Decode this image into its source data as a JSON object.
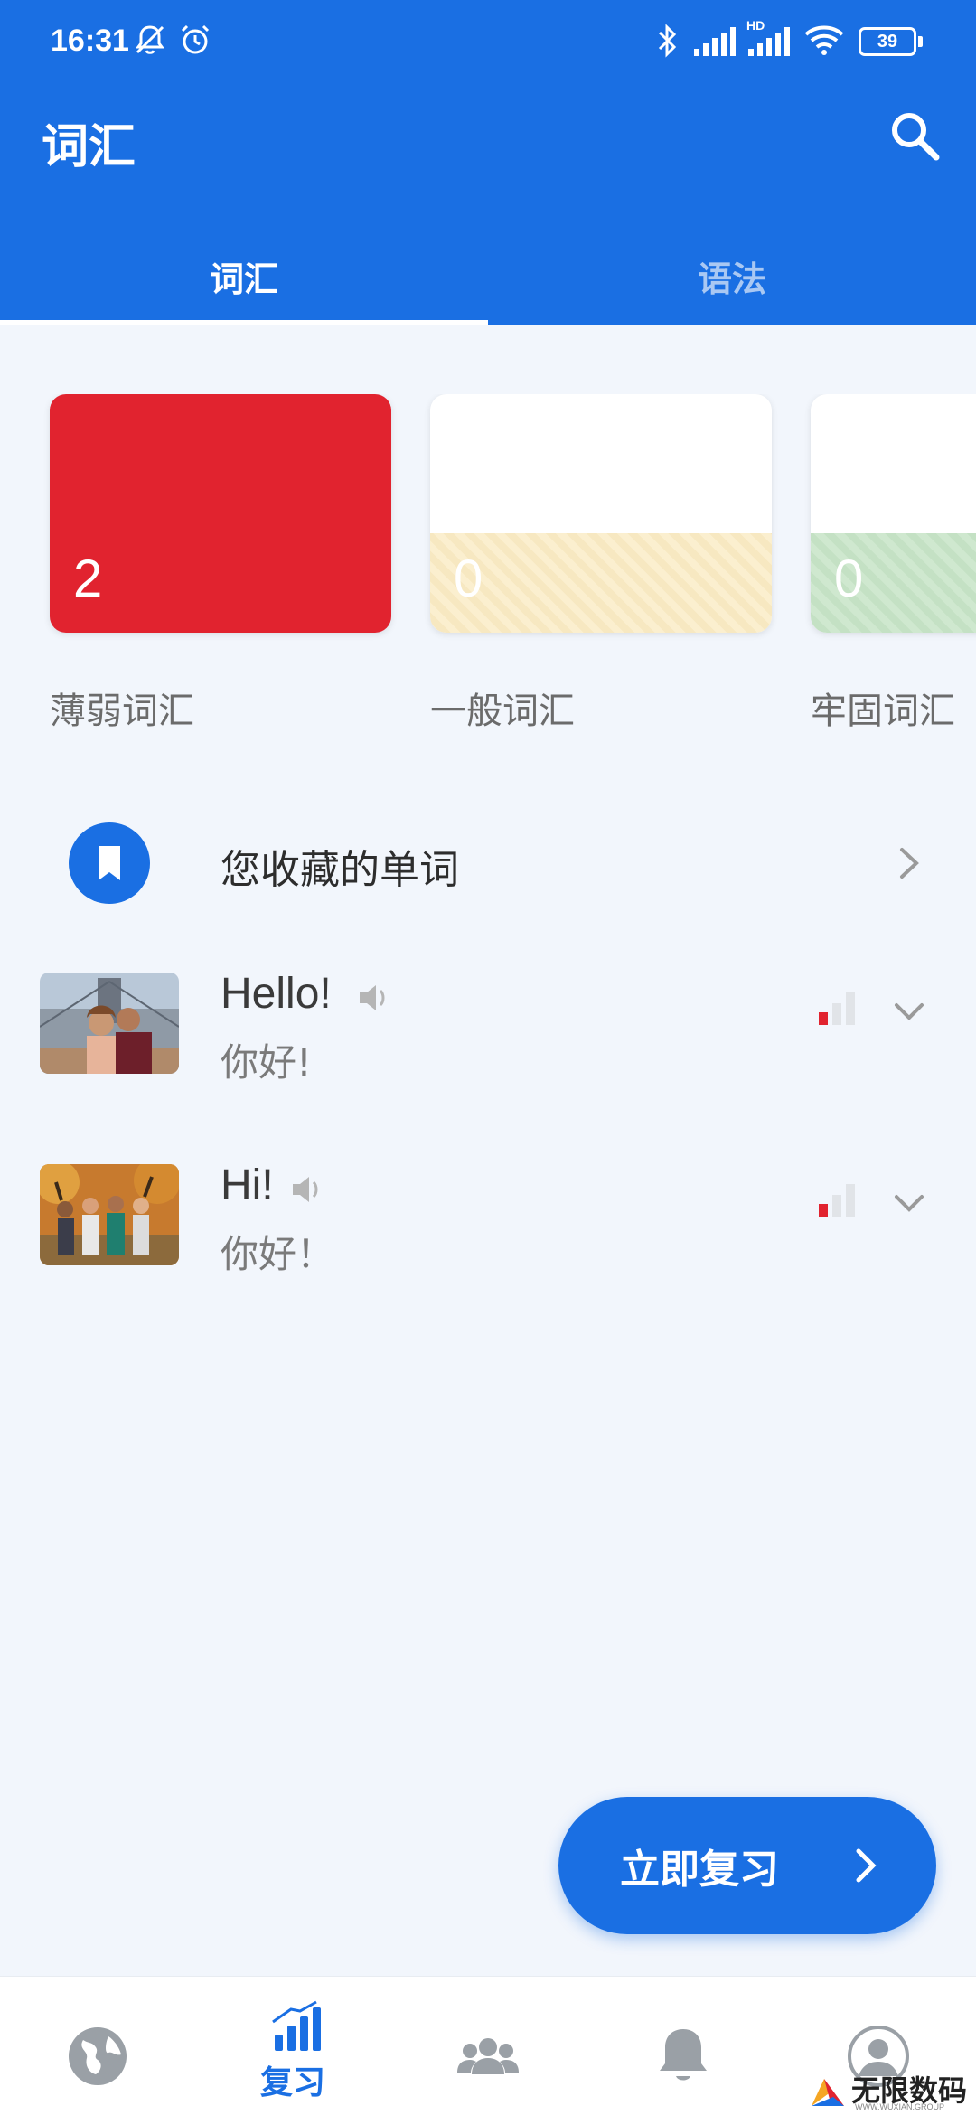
{
  "status_bar": {
    "time": "16:31",
    "battery": "39",
    "network_label": "HD"
  },
  "app_bar": {
    "title": "词汇",
    "search_icon": "search-icon"
  },
  "tabs": [
    {
      "label": "词汇",
      "active": true
    },
    {
      "label": "语法",
      "active": false
    }
  ],
  "strength_cards": [
    {
      "label": "薄弱词汇",
      "count": "2",
      "color": "#e1232f"
    },
    {
      "label": "一般词汇",
      "count": "0",
      "color": "#f7e8c1"
    },
    {
      "label": "牢固词汇",
      "count": "0",
      "color": "#c4e1c4"
    }
  ],
  "favorites": {
    "label": "您收藏的单词",
    "icon": "bookmark-icon"
  },
  "words": [
    {
      "word": "Hello!",
      "translation": "你好!",
      "strength_level": 1,
      "strength_max": 3
    },
    {
      "word": "Hi!",
      "translation": "你好！",
      "strength_level": 1,
      "strength_max": 3
    }
  ],
  "fab": {
    "label": "立即复习"
  },
  "bottom_nav": [
    {
      "name": "explore",
      "icon": "globe-icon"
    },
    {
      "name": "review",
      "icon": "chart-icon",
      "label": "复习",
      "active": true
    },
    {
      "name": "community",
      "icon": "people-icon"
    },
    {
      "name": "notifications",
      "icon": "bell-icon"
    },
    {
      "name": "profile",
      "icon": "avatar-icon"
    }
  ],
  "watermark": {
    "text": "无限数码",
    "sub": "WWW.WUXIAN.GROUP"
  },
  "colors": {
    "primary": "#1a6fe3",
    "background": "#f2f6fc",
    "weak": "#e1232f"
  }
}
